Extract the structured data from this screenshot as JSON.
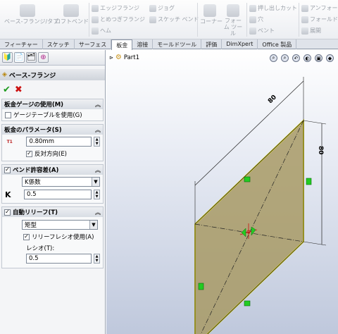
{
  "ribbon": {
    "base_flange": "ベース-フランジ/タブ",
    "lofted_bend": "ロフトベンド",
    "edge_flange": "エッジフランジ",
    "miter_flange": "とめつぎフランジ",
    "hem": "ヘム",
    "jog": "ジョグ",
    "sketched_bend": "スケッチ ベンド",
    "corner": "コーナー",
    "form_tool": "フォーム ツール",
    "extruded_cut": "押し出しカット",
    "hole": "穴",
    "vent": "ベント",
    "unfold": "アンフォールド",
    "fold": "フォールド",
    "flatten": "展開"
  },
  "tabs": [
    "フィーチャー",
    "スケッチ",
    "サーフェス",
    "板金",
    "溶接",
    "モールドツール",
    "評価",
    "DimXpert",
    "Office 製品"
  ],
  "active_tab": "板金",
  "panel": {
    "title": "ベース-フランジ",
    "gauge_group": {
      "header": "板金ゲージの使用(M)",
      "use_gauge_table": "ゲージテーブルを使用(G)"
    },
    "params_group": {
      "header": "板金のパラメータ(S)",
      "thickness_symbol": "T1",
      "thickness": "0.80mm",
      "reverse_direction": "反対方向(E)"
    },
    "bend_group": {
      "header": "ベンド許容差(A)",
      "type": "K係数",
      "k_label": "K",
      "k_value": "0.5"
    },
    "relief_group": {
      "header": "自動リリーフ(T)",
      "type": "矩型",
      "use_relief_ratio": "リリーフレシオ使用(A)",
      "ratio_label": "レシオ(T):",
      "ratio_value": "0.5"
    }
  },
  "viewport": {
    "part_name": "Part1",
    "dim_top": "80",
    "dim_side": "80"
  },
  "colors": {
    "plate_fill": "#a89a65",
    "plate_edge": "#e8e030",
    "handle": "#22cc22"
  }
}
